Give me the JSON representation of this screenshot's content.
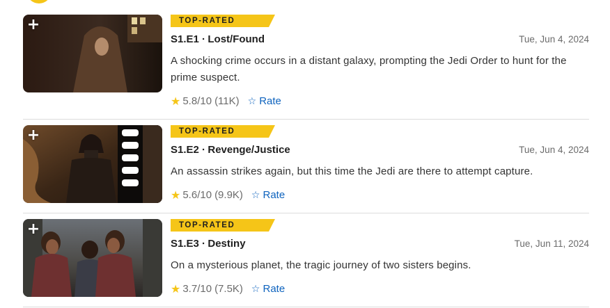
{
  "episodes": [
    {
      "badge": "TOP-RATED",
      "title": "S1.E1 ∙ Lost/Found",
      "date": "Tue, Jun 4, 2024",
      "description": "A shocking crime occurs in a distant galaxy, prompting the Jedi Order to hunt for the prime suspect.",
      "rating": "5.8",
      "rating_max": "/10",
      "votes": "(11K)",
      "rate_label": "Rate"
    },
    {
      "badge": "TOP-RATED",
      "title": "S1.E2 ∙ Revenge/Justice",
      "date": "Tue, Jun 4, 2024",
      "description": "An assassin strikes again, but this time the Jedi are there to attempt capture.",
      "rating": "5.6",
      "rating_max": "/10",
      "votes": "(9.9K)",
      "rate_label": "Rate"
    },
    {
      "badge": "TOP-RATED",
      "title": "S1.E3 ∙ Destiny",
      "date": "Tue, Jun 11, 2024",
      "description": "On a mysterious planet, the tragic journey of two sisters begins.",
      "rating": "3.7",
      "rating_max": "/10",
      "votes": "(7.5K)",
      "rate_label": "Rate"
    }
  ],
  "icons": {
    "watchlist": "plus-icon",
    "rating": "star-icon",
    "rate": "star-outline-icon"
  },
  "colors": {
    "accent": "#f5c518",
    "link": "#0e63be"
  }
}
